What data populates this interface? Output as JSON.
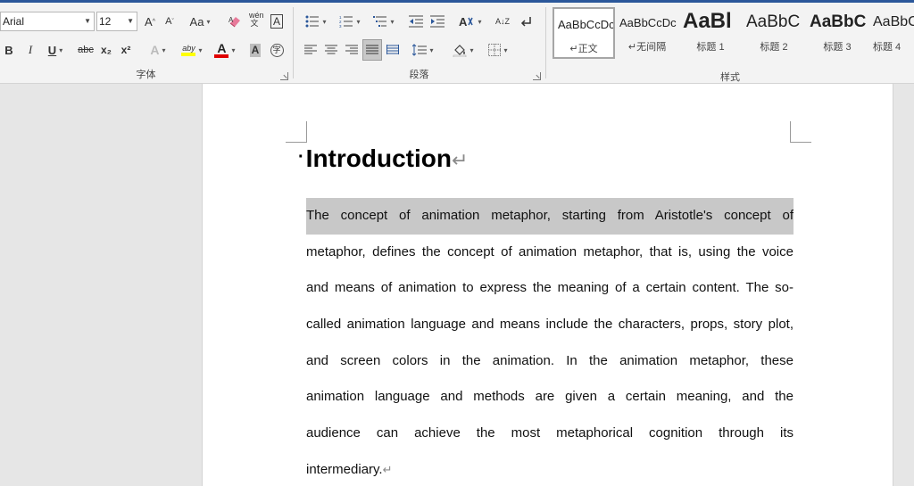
{
  "font_group": {
    "label": "字体",
    "font_name": "Arial",
    "font_size": "12",
    "grow_label": "A",
    "shrink_label": "A",
    "change_case_label": "Aa",
    "phonetic_label": "wén 文",
    "charborder_label": "A",
    "bold_label": "B",
    "italic_label": "I",
    "underline_label": "U",
    "strike_label": "abc",
    "subscript_label": "x₂",
    "superscript_label": "x²",
    "effects_label": "A",
    "highlight_label": "aby",
    "fontcolor_label": "A",
    "shading_label": "A",
    "encircle_label": "字",
    "highlight_color": "#ffff00",
    "fontcolor_color": "#e00000"
  },
  "paragraph_group": {
    "label": "段落",
    "sort_label": "A↓Z"
  },
  "styles_group": {
    "label": "样式",
    "tiles": [
      {
        "sample": "AaBbCcDc",
        "name": "↵正文"
      },
      {
        "sample": "AaBbCcDc",
        "name": "↵无间隔"
      },
      {
        "sample": "AaBl",
        "name": "标题 1"
      },
      {
        "sample": "AaBbC",
        "name": "标题 2"
      },
      {
        "sample": "AaBbC",
        "name": "标题 3"
      },
      {
        "sample": "AaBbC",
        "name": "标题 4"
      }
    ]
  },
  "document": {
    "heading": "Introduction",
    "heading_bullet": "·",
    "paragraph_mark": "↵",
    "lines": [
      "The concept of animation metaphor, starting from Aristotle's concept of",
      "metaphor, defines the concept of animation metaphor, that is, using the voice",
      "and means of animation to express the meaning of a certain content. The so-",
      "called animation language and means include the characters, props, story plot,",
      "and screen colors in the animation. In the animation metaphor, these",
      "animation language and methods are given a certain meaning, and the",
      "audience can achieve the most metaphorical cognition through its",
      "intermediary."
    ]
  }
}
